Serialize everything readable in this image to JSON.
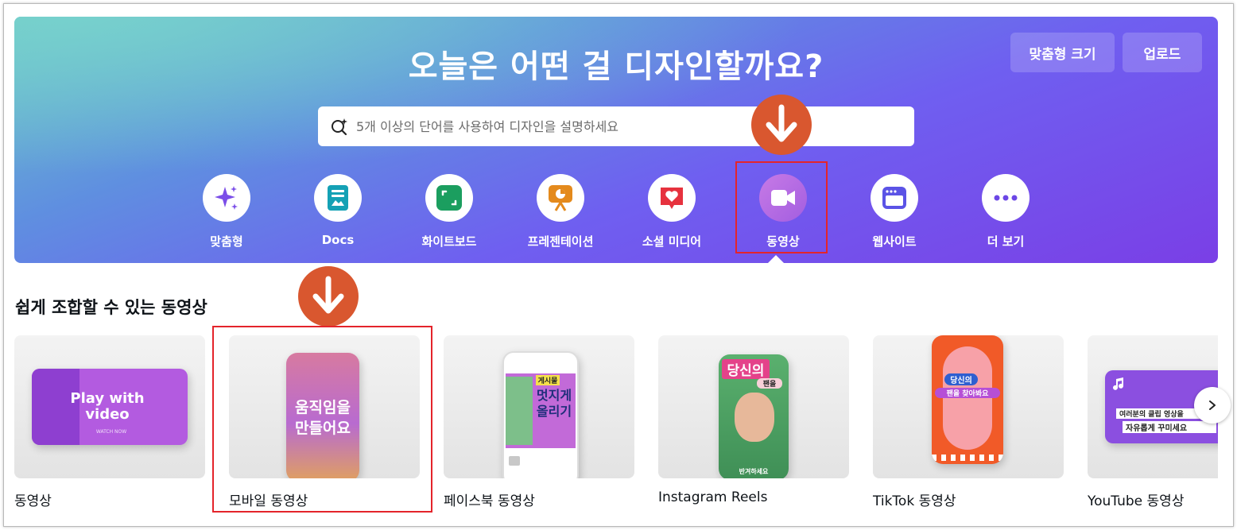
{
  "hero": {
    "title": "오늘은 어떤 걸 디자인할까요?",
    "custom_size_label": "맞춤형 크기",
    "upload_label": "업로드",
    "search_placeholder": "5개 이상의 단어를 사용하여 디자인을 설명하세요"
  },
  "categories": [
    {
      "label": "맞춤형",
      "icon": "sparkle-icon",
      "color": "#7b4ee8"
    },
    {
      "label": "Docs",
      "icon": "docs-icon",
      "color": "#14a1b5"
    },
    {
      "label": "화이트보드",
      "icon": "whiteboard-icon",
      "color": "#1b9e5f"
    },
    {
      "label": "프레젠테이션",
      "icon": "presentation-icon",
      "color": "#e48a1c"
    },
    {
      "label": "소셜 미디어",
      "icon": "heart-icon",
      "color": "#e6323e"
    },
    {
      "label": "동영상",
      "icon": "video-camera-icon",
      "color": "#a35ee0"
    },
    {
      "label": "웹사이트",
      "icon": "website-icon",
      "color": "#5b53e6"
    },
    {
      "label": "더 보기",
      "icon": "more-icon",
      "color": "#6c47e6"
    }
  ],
  "section": {
    "title": "쉽게 조합할 수 있는 동영상"
  },
  "cards": [
    {
      "label": "동영상",
      "thumb_text": "Play with video",
      "thumb_sub": "WATCH NOW"
    },
    {
      "label": "모바일 동영상",
      "thumb_text": "움직임을 만들어요"
    },
    {
      "label": "페이스북 동영상",
      "thumb_text": "멋지게 올리기",
      "thumb_tag": "게시물"
    },
    {
      "label": "Instagram Reels",
      "thumb_text": "당신의",
      "thumb_tag": "팬을",
      "thumb_sub": "반겨하세요"
    },
    {
      "label": "TikTok 동영상",
      "thumb_text": "당신의",
      "thumb_sub": "팬을 찾아봐요"
    },
    {
      "label": "YouTube 동영상",
      "thumb_text": "여러분의 클립 영상을",
      "thumb_sub": "자유롭게 꾸미세요"
    }
  ],
  "colors": {
    "highlight": "#e4242b",
    "arrow_badge": "#d9572f"
  }
}
